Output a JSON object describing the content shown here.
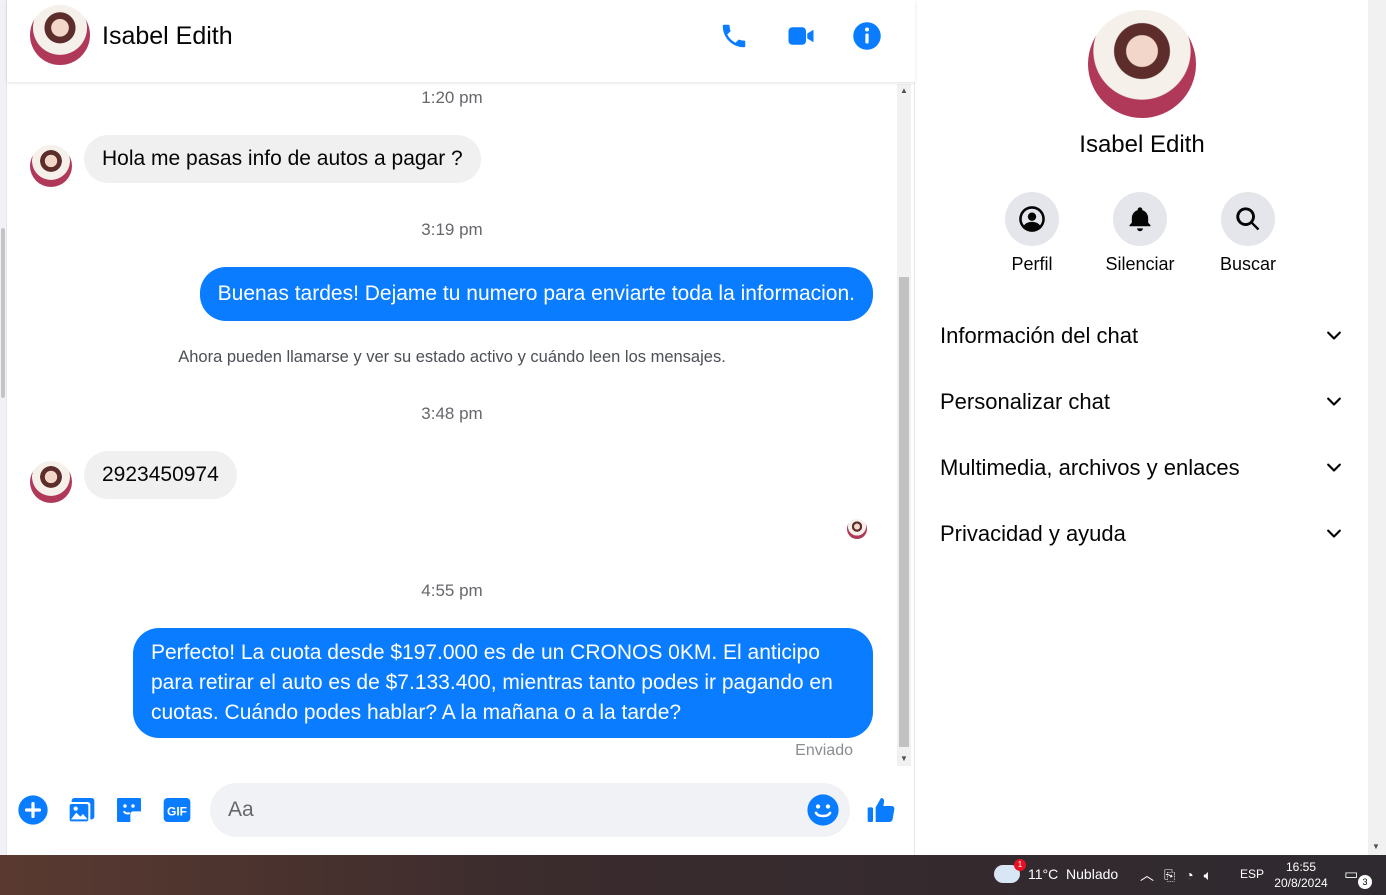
{
  "contact": {
    "name": "Isabel Edith"
  },
  "header": {
    "call_icon": "phone-icon",
    "video_icon": "video-camera-icon",
    "info_icon": "info-icon"
  },
  "messages": [
    {
      "type": "timestamp",
      "text": "1:20 pm"
    },
    {
      "type": "incoming",
      "text": "Hola me pasas info de autos a pagar ?"
    },
    {
      "type": "timestamp",
      "text": "3:19 pm"
    },
    {
      "type": "outgoing",
      "text": "Buenas tardes! Dejame tu numero para enviarte toda la informacion."
    },
    {
      "type": "system",
      "text": "Ahora pueden llamarse y ver su estado activo y cuándo leen los mensajes."
    },
    {
      "type": "timestamp",
      "text": "3:48 pm"
    },
    {
      "type": "incoming",
      "text": "2923450974"
    },
    {
      "type": "timestamp",
      "text": "4:55 pm"
    },
    {
      "type": "outgoing",
      "text": "Perfecto! La cuota desde $197.000 es de un CRONOS 0KM. El anticipo para retirar el auto es de $7.133.400, mientras tanto podes ir pagando en cuotas. Cuándo podes hablar? A la mañana o a la tarde?"
    },
    {
      "type": "status",
      "text": "Enviado"
    }
  ],
  "composer": {
    "placeholder": "Aa",
    "icons": [
      "plus-circle-icon",
      "photo-icon",
      "sticker-icon",
      "gif-icon",
      "emoji-icon",
      "thumbs-up-icon"
    ],
    "gif_label": "GIF"
  },
  "info_panel": {
    "actions": [
      {
        "label": "Perfil",
        "icon": "profile-icon"
      },
      {
        "label": "Silenciar",
        "icon": "bell-icon"
      },
      {
        "label": "Buscar",
        "icon": "search-icon"
      }
    ],
    "sections": [
      {
        "label": "Información del chat"
      },
      {
        "label": "Personalizar chat"
      },
      {
        "label": "Multimedia, archivos y enlaces"
      },
      {
        "label": "Privacidad y ayuda"
      }
    ]
  },
  "taskbar": {
    "weather": "11°C  Nublado",
    "weather_badge": "1",
    "language": "ESP",
    "time": "16:55",
    "date": "20/8/2024",
    "notifications": "3"
  },
  "colors": {
    "accent": "#0a7cff",
    "incoming_bubble": "#f0f0f0",
    "outgoing_bubble": "#0a7cff"
  }
}
